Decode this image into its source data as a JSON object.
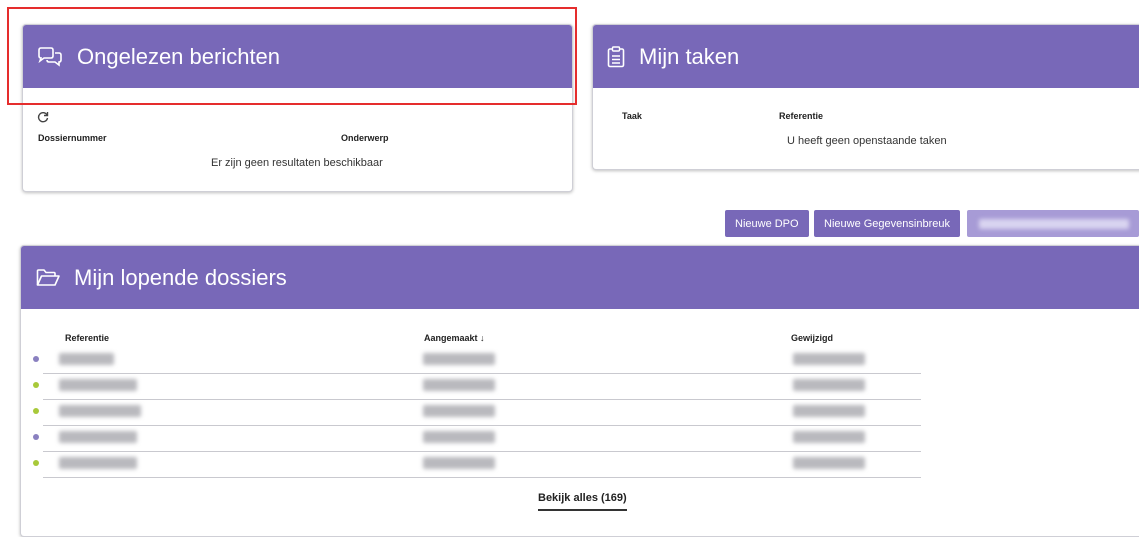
{
  "messages_card": {
    "title": "Ongelezen berichten",
    "col_dossier": "Dossiernummer",
    "col_subject": "Onderwerp",
    "empty": "Er zijn geen resultaten beschikbaar"
  },
  "tasks_card": {
    "title": "Mijn taken",
    "col_task": "Taak",
    "col_reference": "Referentie",
    "empty": "U heeft geen openstaande taken"
  },
  "actions": {
    "new_dpo": "Nieuwe DPO",
    "new_breach": "Nieuwe Gegevensinbreuk"
  },
  "dossiers_card": {
    "title": "Mijn lopende dossiers",
    "col_reference": "Referentie",
    "col_created": "Aangemaakt ↓",
    "col_modified": "Gewijzigd",
    "view_all": "Bekijk alles (169)",
    "rows": [
      {
        "status_color": "#8a80c0"
      },
      {
        "status_color": "#a8c93a"
      },
      {
        "status_color": "#a8c93a"
      },
      {
        "status_color": "#8a80c0"
      },
      {
        "status_color": "#a8c93a"
      }
    ]
  },
  "colors": {
    "header": "#7868b8",
    "highlight": "#e52d2d"
  }
}
